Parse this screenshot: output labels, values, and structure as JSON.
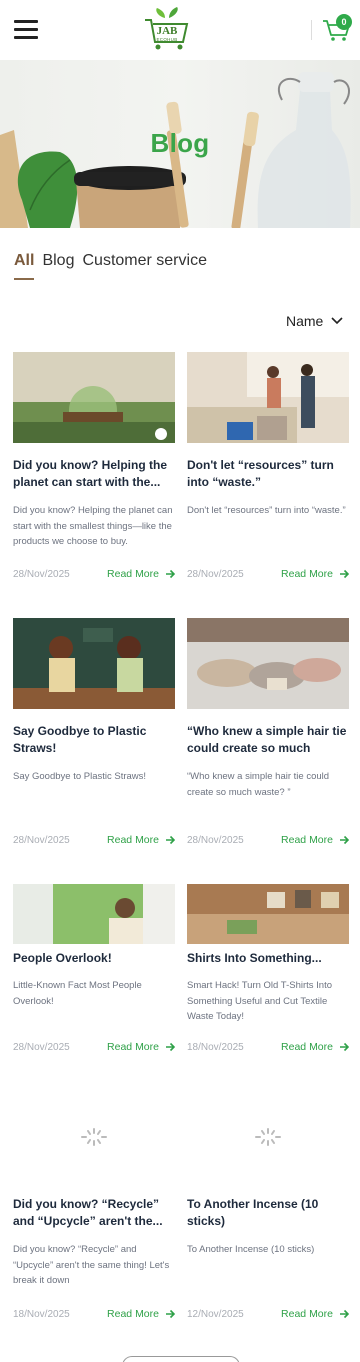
{
  "header": {
    "logo_text": "JAB",
    "logo_sub": "ECOHUB",
    "cart_count": "0",
    "accent": "#2faa4a"
  },
  "hero": {
    "title": "Blog"
  },
  "tabs": [
    {
      "label": "All"
    },
    {
      "label": "Blog"
    },
    {
      "label": "Customer service"
    }
  ],
  "sort": {
    "label": "Name"
  },
  "posts": [
    {
      "title": "Did you know? Helping the planet can start with the...",
      "excerpt": "Did you know? Helping the planet can start with the smallest things—like the products we choose to buy.",
      "date": "28/Nov/2025",
      "read_more": "Read More"
    },
    {
      "title": "Don't let “resources” turn into “waste.”",
      "excerpt": "Don't let “resources” turn into “waste.”",
      "date": "28/Nov/2025",
      "read_more": "Read More"
    },
    {
      "title": "Say Goodbye to Plastic Straws!",
      "excerpt": "Say Goodbye to Plastic Straws!",
      "date": "28/Nov/2025",
      "read_more": "Read More"
    },
    {
      "title": "“Who knew a simple hair tie could create so much wast...",
      "excerpt": "“Who knew a simple hair tie could create so much waste? ”",
      "date": "28/Nov/2025",
      "read_more": "Read More"
    },
    {
      "title": "People Overlook!",
      "excerpt": "Little-Known Fact Most People Overlook!",
      "date": "28/Nov/2025",
      "read_more": "Read More"
    },
    {
      "title": "Shirts Into Something...",
      "excerpt": "Smart Hack! Turn Old T-Shirts Into Something Useful and Cut Textile Waste Today!",
      "date": "18/Nov/2025",
      "read_more": "Read More"
    },
    {
      "title": "Did you know? “Recycle” and “Upcycle” aren't the...",
      "excerpt": "Did you know? “Recycle” and “Upcycle” aren't the same thing! Let's break it down",
      "date": "18/Nov/2025",
      "read_more": "Read More"
    },
    {
      "title": "To Another Incense (10 sticks)",
      "excerpt": "To Another Incense (10 sticks)",
      "date": "12/Nov/2025",
      "read_more": "Read More"
    }
  ]
}
